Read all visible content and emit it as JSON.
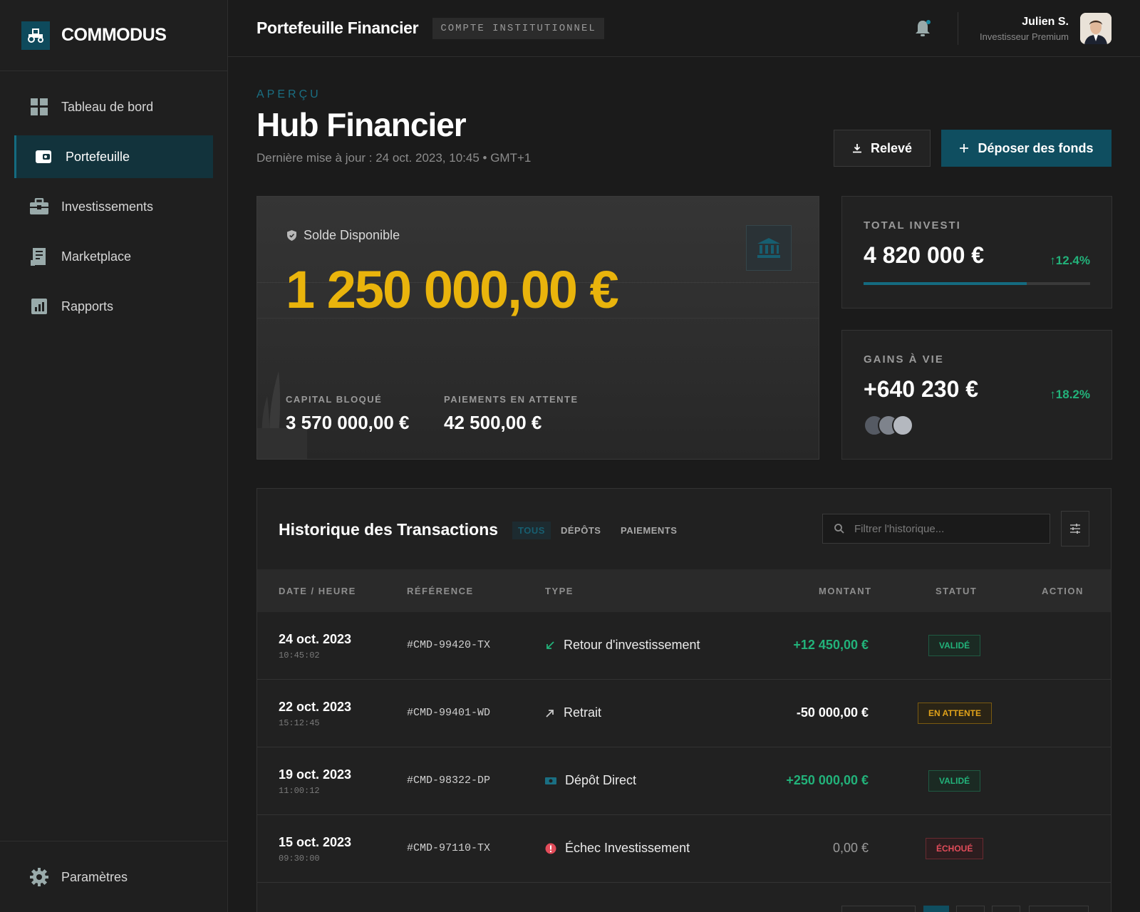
{
  "brand": {
    "name": "COMMODUS"
  },
  "sidebar": {
    "items": [
      {
        "label": "Tableau de bord",
        "icon": "dashboard-icon"
      },
      {
        "label": "Portefeuille",
        "icon": "wallet-icon",
        "active": true
      },
      {
        "label": "Investissements",
        "icon": "briefcase-icon"
      },
      {
        "label": "Marketplace",
        "icon": "receipt-icon"
      },
      {
        "label": "Rapports",
        "icon": "chart-icon"
      }
    ],
    "settings": {
      "label": "Paramètres",
      "icon": "gear-icon"
    }
  },
  "header": {
    "title": "Portefeuille Financier",
    "badge": "COMPTE INSTITUTIONNEL",
    "user": {
      "name": "Julien S.",
      "role": "Investisseur Premium"
    }
  },
  "main": {
    "eyebrow": "APERÇU",
    "title": "Hub Financier",
    "updated": "Dernière mise à jour : 24 oct. 2023, 10:45 • GMT+1",
    "btn_statement": "Relevé",
    "btn_deposit": "Déposer des fonds"
  },
  "balance": {
    "label": "Solde Disponible",
    "amount": "1 250 000,00 €",
    "locked_label": "CAPITAL BLOQUÉ",
    "locked_value": "3 570 000,00 €",
    "pending_label": "PAIEMENTS EN ATTENTE",
    "pending_value": "42 500,00 €"
  },
  "stats": {
    "invested": {
      "label": "TOTAL INVESTI",
      "value": "4 820 000 €",
      "change": "12.4%",
      "progress": 0.72
    },
    "gains": {
      "label": "GAINS À VIE",
      "value": "+640 230 €",
      "change": "18.2%"
    }
  },
  "colors": {
    "accent": "#0f4e60",
    "gold": "#e9b40c",
    "positive": "#22b27a",
    "warning": "#e0a21a",
    "danger": "#e24c5a"
  },
  "transactions": {
    "title": "Historique des Transactions",
    "tabs": [
      "TOUS",
      "DÉPÔTS",
      "PAIEMENTS"
    ],
    "search_placeholder": "Filtrer l'historique...",
    "columns": [
      "DATE / HEURE",
      "RÉFÉRENCE",
      "TYPE",
      "MONTANT",
      "STATUT",
      "ACTION"
    ],
    "rows": [
      {
        "date": "24 oct. 2023",
        "time": "10:45:02",
        "ref": "#CMD-99420-TX",
        "type": "Retour d'investissement",
        "icon": "arrow-down-left-icon",
        "amount": "+12 450,00 €",
        "status": "VALIDÉ",
        "status_kind": "ok"
      },
      {
        "date": "22 oct. 2023",
        "time": "15:12:45",
        "ref": "#CMD-99401-WD",
        "type": "Retrait",
        "icon": "arrow-up-right-icon",
        "amount": "-50 000,00 €",
        "status": "EN ATTENTE",
        "status_kind": "wait"
      },
      {
        "date": "19 oct. 2023",
        "time": "11:00:12",
        "ref": "#CMD-98322-DP",
        "type": "Dépôt Direct",
        "icon": "cash-icon",
        "amount": "+250 000,00 €",
        "status": "VALIDÉ",
        "status_kind": "ok"
      },
      {
        "date": "15 oct. 2023",
        "time": "09:30:00",
        "ref": "#CMD-97110-TX",
        "type": "Échec Investissement",
        "icon": "alert-icon",
        "amount": "0,00 €",
        "status": "ÉCHOUÉ",
        "status_kind": "fail"
      }
    ]
  }
}
